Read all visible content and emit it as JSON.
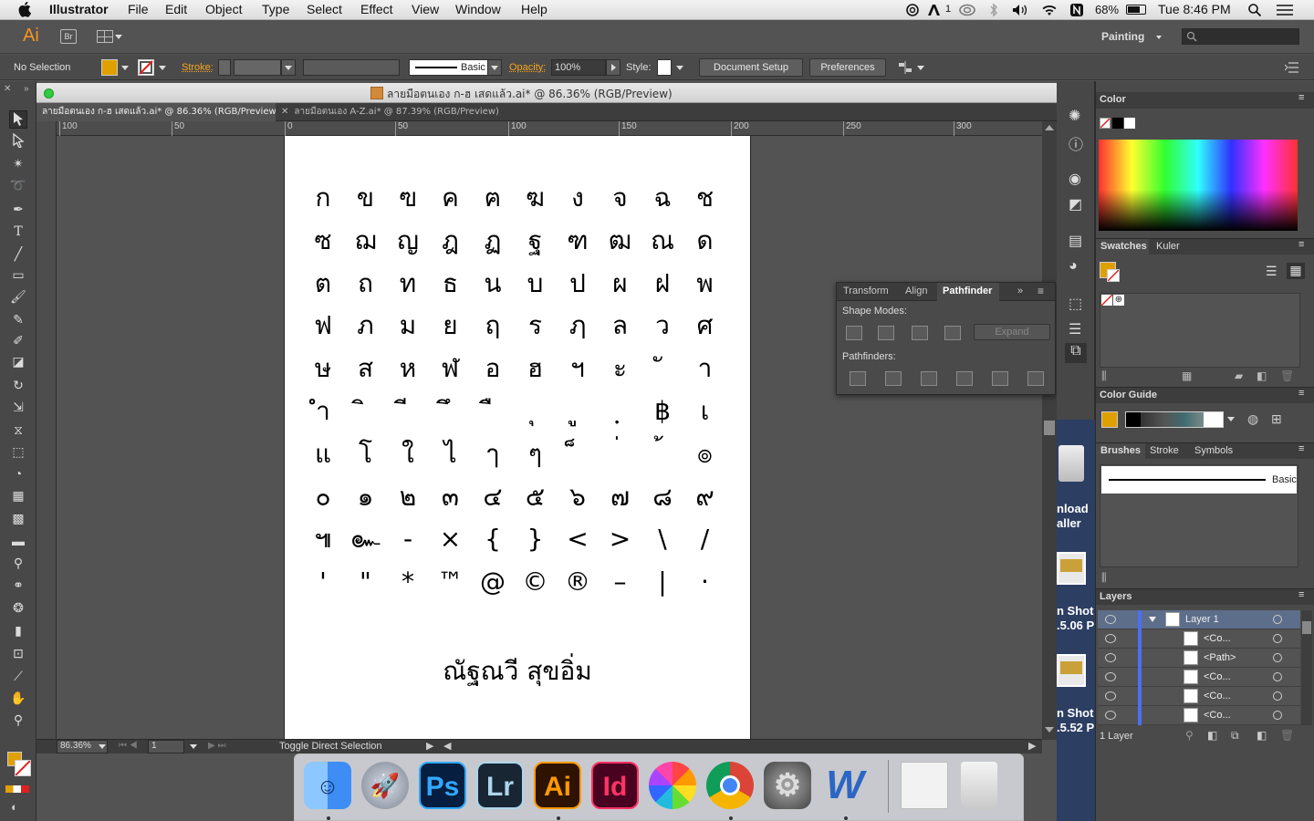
{
  "menubar": {
    "app_name": "Illustrator",
    "menus": [
      "File",
      "Edit",
      "Object",
      "Type",
      "Select",
      "Effect",
      "View",
      "Window",
      "Help"
    ],
    "status_icons": [
      "creative-cloud-icon",
      "adobe-icon",
      "sync-icon",
      "bluetooth-icon",
      "volume-icon",
      "wifi-icon",
      "n-icon"
    ],
    "badge_count": "1",
    "battery": "68%",
    "clock": "Tue 8:46 PM"
  },
  "appbar": {
    "ai_logo": "Ai",
    "bridge": "Br",
    "workspace": "Painting"
  },
  "control": {
    "selection": "No Selection",
    "stroke_label": "Stroke:",
    "brush": "Basic",
    "opacity_label": "Opacity:",
    "opacity_value": "100%",
    "style_label": "Style:",
    "document_setup": "Document Setup",
    "preferences": "Preferences",
    "fill_color": "#e0a000"
  },
  "document": {
    "window_title": "ลายมือตนเอง ก-ฮ เสดแล้ว.ai* @ 86.36% (RGB/Preview)",
    "tabs": [
      "ลายมือตนเอง ก-ฮ เสดแล้ว.ai* @ 86.36% (RGB/Preview)",
      "ลายมือตนเอง A-Z.ai* @ 87.39% (RGB/Preview)"
    ],
    "ruler_ticks": [
      "100",
      "50",
      "0",
      "50",
      "100",
      "150",
      "200",
      "250",
      "300"
    ],
    "rows": [
      [
        "ก",
        "ข",
        "ฃ",
        "ค",
        "ฅ",
        "ฆ",
        "ง",
        "จ",
        "ฉ",
        "ช"
      ],
      [
        "ซ",
        "ฌ",
        "ญ",
        "ฎ",
        "ฏ",
        "ฐ",
        "ฑ",
        "ฒ",
        "ณ",
        "ด"
      ],
      [
        "ต",
        "ถ",
        "ท",
        "ธ",
        "น",
        "บ",
        "ป",
        "ผ",
        "ฝ",
        "พ"
      ],
      [
        "ฟ",
        "ภ",
        "ม",
        "ย",
        "ฤ",
        "ร",
        "ฦ",
        "ล",
        "ว",
        "ศ"
      ],
      [
        "ษ",
        "ส",
        "ห",
        "ฬ",
        "อ",
        "ฮ",
        "ฯ",
        "ะ",
        "ั",
        "า"
      ],
      [
        "ำ",
        "ิ",
        "ี",
        "ึ",
        "ื",
        "ุ",
        "ู",
        "ฺ",
        "฿",
        "เ"
      ],
      [
        "แ",
        "โ",
        "ใ",
        "ไ",
        "ๅ",
        "ๆ",
        "็",
        "่",
        "้",
        "๏"
      ],
      [
        "๐",
        "๑",
        "๒",
        "๓",
        "๔",
        "๕",
        "๖",
        "๗",
        "๘",
        "๙"
      ],
      [
        "๚",
        "๛",
        "-",
        "×",
        "{",
        "}",
        "<",
        ">",
        "\\",
        "/"
      ],
      [
        "'",
        "\"",
        "*",
        "™",
        "@",
        "©",
        "®",
        "–",
        "|",
        "·"
      ]
    ],
    "signature": "ณัฐณวี  สุขอิ่ม"
  },
  "status": {
    "zoom": "86.36%",
    "page": "1",
    "hint": "Toggle Direct Selection"
  },
  "pathfinder": {
    "tabs": [
      "Transform",
      "Align",
      "Pathfinder"
    ],
    "shape_modes_label": "Shape Modes:",
    "expand_label": "Expand",
    "pathfinders_label": "Pathfinders:"
  },
  "panels": {
    "color_title": "Color",
    "swatches_tab": "Swatches",
    "kuler_tab": "Kuler",
    "color_guide_title": "Color Guide",
    "brushes_tab": "Brushes",
    "stroke_tab": "Stroke",
    "symbols_tab": "Symbols",
    "brush_name": "Basic",
    "layers_title": "Layers",
    "layers": [
      {
        "name": "Layer 1",
        "type": "layer"
      },
      {
        "name": "<Co...",
        "type": "item"
      },
      {
        "name": "<Path>",
        "type": "item"
      },
      {
        "name": "<Co...",
        "type": "item"
      },
      {
        "name": "<Co...",
        "type": "item"
      },
      {
        "name": "<Co...",
        "type": "item"
      }
    ],
    "layers_count": "1 Layer"
  },
  "desktop": {
    "items": [
      "nload",
      "aller",
      "n Shot",
      ".5.06 P",
      "n Shot",
      ".5.52 P"
    ]
  },
  "dock": {
    "apps": [
      {
        "name": "Finder",
        "label": "",
        "bg": "#3d8df5"
      },
      {
        "name": "Launchpad",
        "label": "",
        "bg": "#9aa3b2"
      },
      {
        "name": "Photoshop",
        "label": "Ps",
        "bg": "#061e3f",
        "fg": "#31a8ff"
      },
      {
        "name": "Lightroom",
        "label": "Lr",
        "bg": "#182634",
        "fg": "#add5ec"
      },
      {
        "name": "Illustrator",
        "label": "Ai",
        "bg": "#2e1400",
        "fg": "#ff9a00"
      },
      {
        "name": "InDesign",
        "label": "Id",
        "bg": "#49021f",
        "fg": "#ff3366"
      },
      {
        "name": "Photos",
        "label": "",
        "bg": "#ffffff"
      },
      {
        "name": "Chrome",
        "label": "",
        "bg": "#ffffff"
      },
      {
        "name": "System Preferences",
        "label": "",
        "bg": "#6b6b6b"
      },
      {
        "name": "Word",
        "label": "W",
        "bg": "#ffffff",
        "fg": "#2b66c4"
      }
    ]
  }
}
